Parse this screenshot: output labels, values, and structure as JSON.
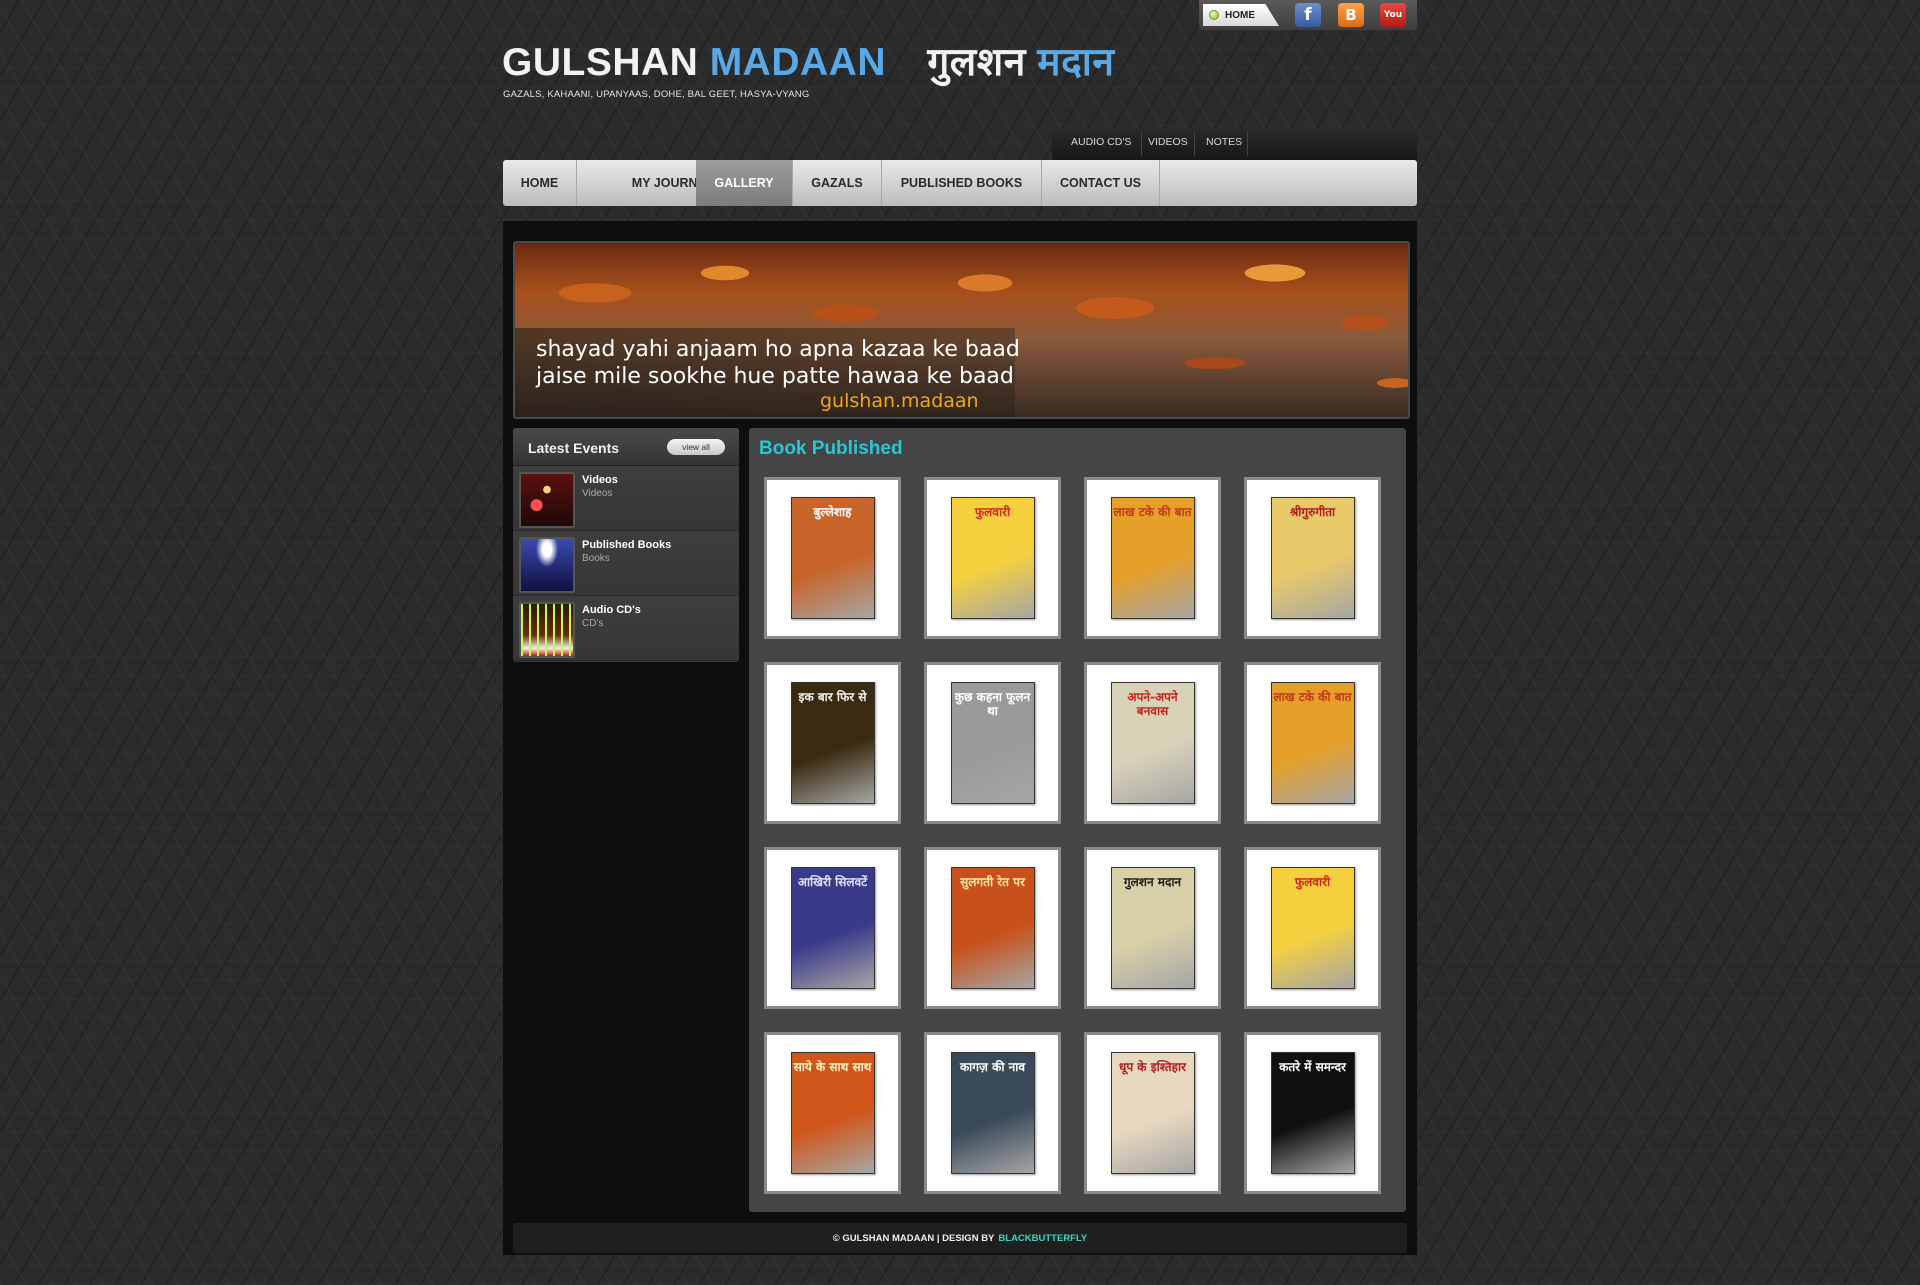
{
  "topbar": {
    "home_label": "HOME",
    "social": [
      {
        "name": "facebook",
        "glyph": "f"
      },
      {
        "name": "blogger",
        "glyph": "B"
      },
      {
        "name": "youtube",
        "glyph": "You"
      }
    ]
  },
  "logo": {
    "first": "GULSHAN",
    "last": "MADAAN",
    "hindi_first": "गुलशन",
    "hindi_last": "मदान",
    "tagline": "GAZALS, KAHAANI, UPANYAAS, DOHE, BAL GEET, HASYA-VYANG"
  },
  "submenu": [
    "AUDIO CD'S",
    "VIDEOS",
    "NOTES"
  ],
  "nav": [
    "HOME",
    "MY JOURNEY",
    "GALLERY",
    "GAZALS",
    "PUBLISHED BOOKS",
    "CONTACT US"
  ],
  "nav_active": "GALLERY",
  "banner": {
    "line1": "shayad yahi anjaam ho apna kazaa ke baad",
    "line2": "jaise mile sookhe hue patte hawaa ke baad",
    "signature": "gulshan.madaan"
  },
  "events": {
    "title": "Latest Events",
    "view_all": "view all",
    "items": [
      {
        "title": "Videos",
        "subtitle": "Videos"
      },
      {
        "title": "Published Books",
        "subtitle": "Books"
      },
      {
        "title": "Audio CD's",
        "subtitle": "CD's"
      }
    ]
  },
  "gallery": {
    "title": "Book Published",
    "books": [
      {
        "title": "बुल्लेशाह",
        "bg": "#c8642a",
        "fg": "#ffffff"
      },
      {
        "title": "फुलवारी",
        "bg": "#f4d03f",
        "fg": "#d1261c"
      },
      {
        "title": "लाख टके की बात",
        "bg": "#e6a02a",
        "fg": "#c23a1a"
      },
      {
        "title": "श्रीगुरुगीता",
        "bg": "#e8c96a",
        "fg": "#b01c1c"
      },
      {
        "title": "इक बार फिर से",
        "bg": "#3a2a10",
        "fg": "#f0f0f0"
      },
      {
        "title": "कुछ कहना फूलन था",
        "bg": "#9a9a9a",
        "fg": "#ffffff"
      },
      {
        "title": "अपने-अपने बनवास",
        "bg": "#d8d2b8",
        "fg": "#c8241a"
      },
      {
        "title": "लाख टके की बात",
        "bg": "#e6a02a",
        "fg": "#c23a1a"
      },
      {
        "title": "आखिरी सिलवटें",
        "bg": "#3a3a8a",
        "fg": "#e0e0ff"
      },
      {
        "title": "सुलगती रेत पर",
        "bg": "#c8501a",
        "fg": "#ffe8a0"
      },
      {
        "title": "गुलशन मदान",
        "bg": "#d8d0a8",
        "fg": "#1a1a1a"
      },
      {
        "title": "फुलवारी",
        "bg": "#f4d03f",
        "fg": "#d1261c"
      },
      {
        "title": "साये के साथ साथ",
        "bg": "#d0561a",
        "fg": "#fff3c0"
      },
      {
        "title": "कागज़ की नाव",
        "bg": "#3a4a5a",
        "fg": "#ffffff"
      },
      {
        "title": "धूप के इश्तिहार",
        "bg": "#e8d8c0",
        "fg": "#b01c1c"
      },
      {
        "title": "कतरे में समन्दर",
        "bg": "#101010",
        "fg": "#ffffff"
      }
    ]
  },
  "footer": {
    "text": "© GULSHAN MADAAN | DESIGN BY",
    "link": "BLACKBUTTERFLY"
  },
  "colors": {
    "accent_blue": "#5aa9e6",
    "gallery_title": "#29c6d6",
    "footer_link": "#3fd6c2",
    "banner_signature": "#f0a818"
  }
}
